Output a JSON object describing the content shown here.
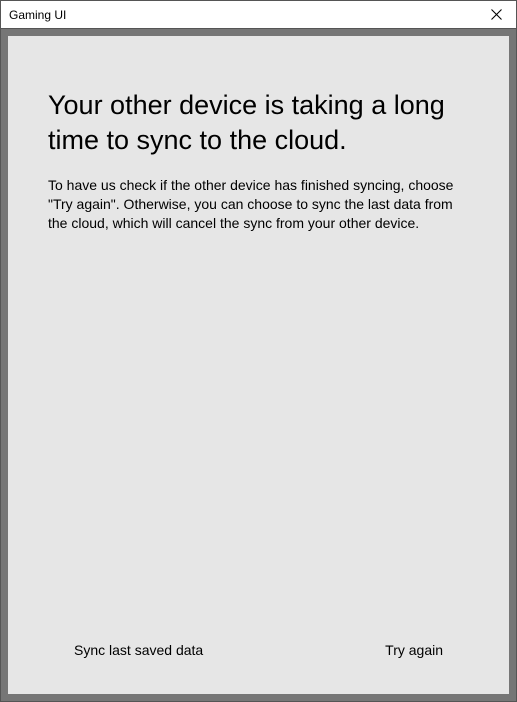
{
  "window": {
    "title": "Gaming UI"
  },
  "dialog": {
    "heading": "Your other device is taking a long time to sync to the cloud.",
    "body": "To have us check if the other device has finished syncing, choose \"Try again\". Otherwise, you can choose to sync the last data from the cloud, which will cancel the sync from your other device."
  },
  "actions": {
    "sync_last": "Sync last saved data",
    "try_again": "Try again"
  }
}
